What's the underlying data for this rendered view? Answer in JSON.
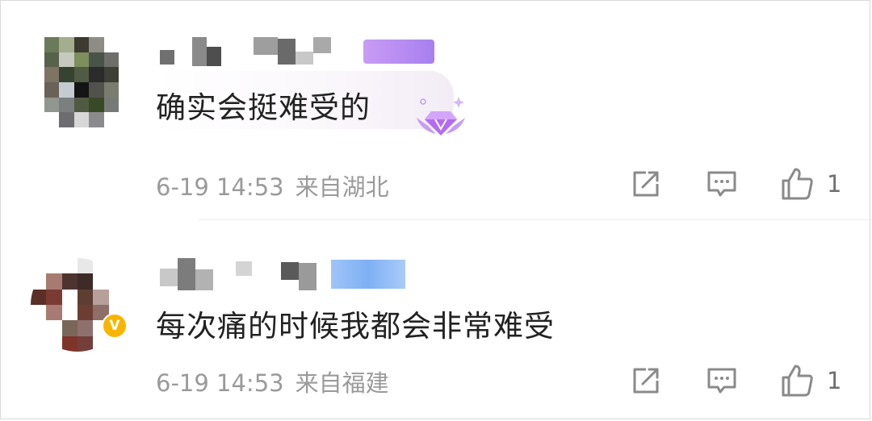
{
  "comments": [
    {
      "text": "确实会挺难受的",
      "date": "6-19 14:53",
      "location": "来自湖北",
      "like_count": "1",
      "has_member_badge": true
    },
    {
      "text": "每次痛的时候我都会非常难受",
      "date": "6-19 14:53",
      "location": "来自福建",
      "like_count": "1",
      "has_verified_badge": true
    }
  ],
  "icons": {
    "share": "share-edit-icon",
    "comment": "comment-icon",
    "like": "thumbs-up-icon",
    "verified": "verified-v-icon",
    "badge": "diamond-badge-icon"
  },
  "verified_glyph": "V",
  "colors": {
    "text": "#222222",
    "meta": "#9a9a9a",
    "icon": "#8a8a8a",
    "verified": "#f8b500",
    "badge": "#b36cf0"
  }
}
